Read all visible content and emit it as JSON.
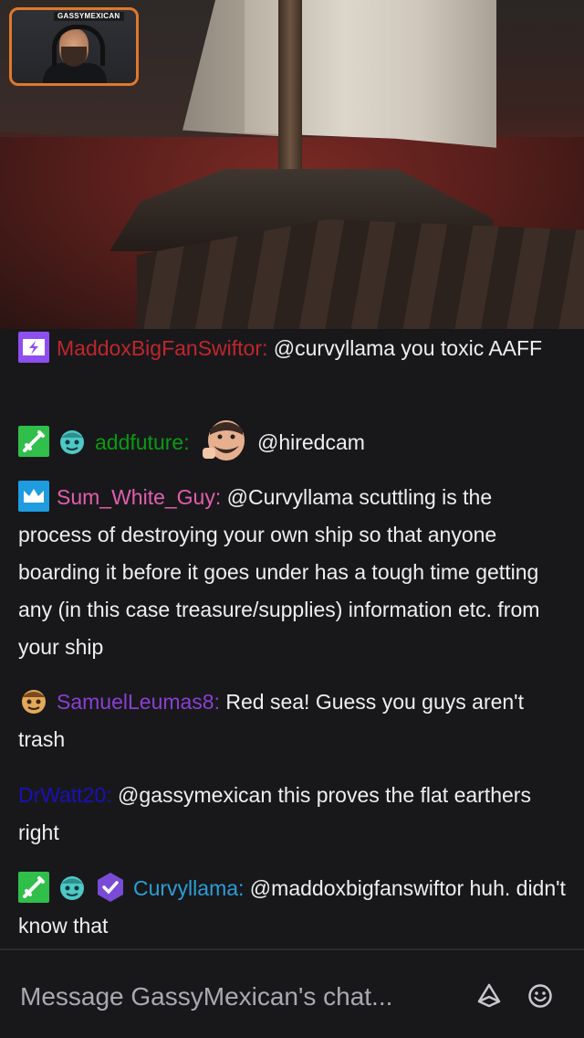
{
  "stream": {
    "webcam_label": "GASSYMEXICAN"
  },
  "chat": {
    "messages": [
      {
        "user": "MaddoxBigFanSwiftor:",
        "text": " @curvyllama you toxic AAFF",
        "color": "#c0262b"
      },
      {
        "user": "addfuture:",
        "text": " @hiredcam",
        "color": "#0a9a12"
      },
      {
        "user": "Sum_White_Guy:",
        "text": " @Curvyllama scuttling is the process of destroying your own ship so that anyone boarding it before it goes under has a tough time getting any (in this case treasure/supplies) information etc. from your ship",
        "color": "#e25fad"
      },
      {
        "user": "SamuelLeumas8:",
        "text": " Red sea! Guess you guys aren't trash",
        "color": "#8a3fd2"
      },
      {
        "user": "DrWatt20:",
        "text": " @gassymexican this proves the flat earthers right",
        "color": "#1a10b8"
      },
      {
        "user": "Curvyllama:",
        "text": " @maddoxbigfanswiftor huh. didn't know that",
        "color": "#2a9fd6"
      }
    ]
  },
  "input": {
    "placeholder": "Message GassyMexican's chat..."
  },
  "icons": {
    "bits": "bits-icon",
    "emote": "emote-picker-icon"
  }
}
